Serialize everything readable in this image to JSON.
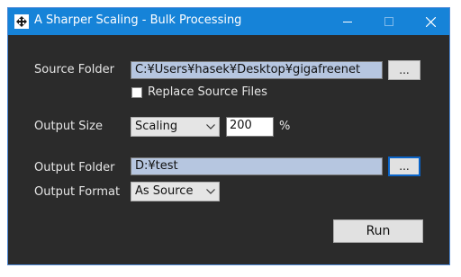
{
  "window": {
    "title": "A Sharper Scaling - Bulk Processing",
    "icons": {
      "app": "app-icon",
      "minimize": "minimize-icon",
      "maximize": "maximize-icon",
      "close": "close-icon"
    },
    "accent": "#1683d8"
  },
  "source": {
    "label": "Source Folder",
    "value": "C:¥Users¥hasek¥Desktop¥gigafreenet",
    "browse_label": "...",
    "replace_label": "Replace Source Files",
    "replace_checked": false
  },
  "output_size": {
    "label": "Output Size",
    "mode": "Scaling",
    "value": "200",
    "unit": "%"
  },
  "output_folder": {
    "label": "Output Folder",
    "value": "D:¥test",
    "browse_label": "..."
  },
  "output_format": {
    "label": "Output Format",
    "value": "As Source"
  },
  "run_label": "Run"
}
